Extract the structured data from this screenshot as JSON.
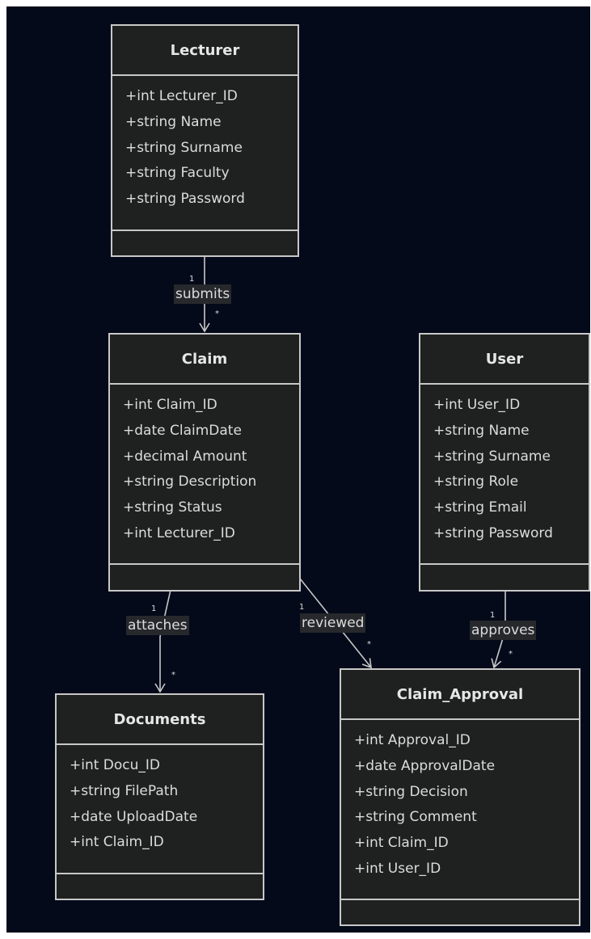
{
  "classes": {
    "lecturer": {
      "name": "Lecturer",
      "attributes": [
        "+int Lecturer_ID",
        "+string Name",
        "+string Surname",
        "+string Faculty",
        "+string Password"
      ]
    },
    "claim": {
      "name": "Claim",
      "attributes": [
        "+int Claim_ID",
        "+date ClaimDate",
        "+decimal Amount",
        "+string Description",
        "+string Status",
        "+int Lecturer_ID"
      ]
    },
    "user": {
      "name": "User",
      "attributes": [
        "+int User_ID",
        "+string Name",
        "+string Surname",
        "+string Role",
        "+string Email",
        "+string Password"
      ]
    },
    "documents": {
      "name": "Documents",
      "attributes": [
        "+int Docu_ID",
        "+string FilePath",
        "+date UploadDate",
        "+int Claim_ID"
      ]
    },
    "claim_approval": {
      "name": "Claim_Approval",
      "attributes": [
        "+int Approval_ID",
        "+date ApprovalDate",
        "+string Decision",
        "+string Comment",
        "+int Claim_ID",
        "+int User_ID"
      ]
    }
  },
  "relations": {
    "submits": {
      "label": "submits",
      "from_mult": "1",
      "to_mult": "*"
    },
    "attaches": {
      "label": "attaches",
      "from_mult": "1",
      "to_mult": "*"
    },
    "reviewed": {
      "label": "reviewed",
      "from_mult": "1",
      "to_mult": "*"
    },
    "approves": {
      "label": "approves",
      "from_mult": "1",
      "to_mult": "*"
    }
  },
  "colors": {
    "background": "#050a1a",
    "box_fill": "#1f2020",
    "stroke": "#c8c8c8",
    "text": "#dcdcdc"
  }
}
